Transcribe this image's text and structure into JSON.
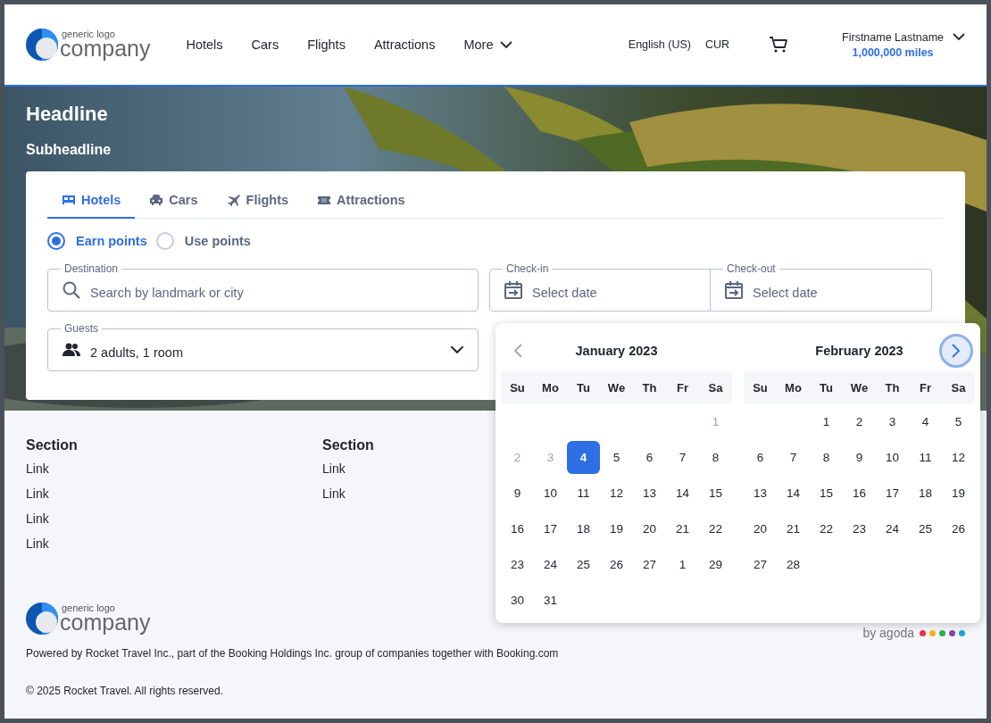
{
  "header": {
    "logo": {
      "tagline": "generic logo",
      "name": "company"
    },
    "nav": [
      {
        "label": "Hotels",
        "has_menu": false
      },
      {
        "label": "Cars",
        "has_menu": false
      },
      {
        "label": "Flights",
        "has_menu": false
      },
      {
        "label": "Attractions",
        "has_menu": false
      },
      {
        "label": "More",
        "has_menu": true
      }
    ],
    "language": "English (US)",
    "currency": "CUR",
    "user": {
      "name": "Firstname Lastname",
      "miles": "1,000,000 miles"
    }
  },
  "hero": {
    "headline": "Headline",
    "subheadline": "Subheadline"
  },
  "search_card": {
    "tabs": [
      {
        "label": "Hotels",
        "selected": true
      },
      {
        "label": "Cars",
        "selected": false
      },
      {
        "label": "Flights",
        "selected": false
      },
      {
        "label": "Attractions",
        "selected": false
      }
    ],
    "point_options": [
      {
        "label": "Earn points",
        "selected": true
      },
      {
        "label": "Use points",
        "selected": false
      }
    ],
    "fields": [
      {
        "kind": "search",
        "label": "Destination",
        "placeholder": "Search by landmark or city"
      },
      {
        "kind": "date",
        "label": "Check-in",
        "placeholder": "Select date"
      },
      {
        "kind": "date",
        "label": "Check-out",
        "placeholder": "Select date"
      },
      {
        "kind": "select",
        "label": "Guests",
        "value": "2 adults, 1 room"
      }
    ]
  },
  "calendar": {
    "prev_button": {
      "disabled": true
    },
    "next_button": {
      "focused": true
    },
    "months": [
      {
        "title": "January  2023",
        "weekdays": [
          "Su",
          "Mo",
          "Tu",
          "We",
          "Th",
          "Fr",
          "Sa"
        ],
        "weeks": [
          {
            "days": [
              {
                "label": "1",
                "disabled": true,
                "selected": false
              }
            ]
          },
          {
            "days": [
              {
                "label": "2",
                "disabled": true,
                "selected": false
              },
              {
                "label": "3",
                "disabled": true,
                "selected": false
              },
              {
                "label": "4",
                "disabled": false,
                "selected": true
              },
              {
                "label": "5",
                "disabled": false,
                "selected": false
              },
              {
                "label": "6",
                "disabled": false,
                "selected": false
              },
              {
                "label": "7",
                "disabled": false,
                "selected": false
              },
              {
                "label": "8",
                "disabled": false,
                "selected": false
              }
            ]
          },
          {
            "days": [
              {
                "label": "9",
                "disabled": false,
                "selected": false
              },
              {
                "label": "10",
                "disabled": false,
                "selected": false
              },
              {
                "label": "11",
                "disabled": false,
                "selected": false
              },
              {
                "label": "12",
                "disabled": false,
                "selected": false
              },
              {
                "label": "13",
                "disabled": false,
                "selected": false
              },
              {
                "label": "14",
                "disabled": false,
                "selected": false
              },
              {
                "label": "15",
                "disabled": false,
                "selected": false
              }
            ]
          },
          {
            "days": [
              {
                "label": "16",
                "disabled": false,
                "selected": false
              },
              {
                "label": "17",
                "disabled": false,
                "selected": false
              },
              {
                "label": "18",
                "disabled": false,
                "selected": false
              },
              {
                "label": "19",
                "disabled": false,
                "selected": false
              },
              {
                "label": "20",
                "disabled": false,
                "selected": false
              },
              {
                "label": "21",
                "disabled": false,
                "selected": false
              },
              {
                "label": "22",
                "disabled": false,
                "selected": false
              }
            ]
          },
          {
            "days": [
              {
                "label": "23",
                "disabled": false,
                "selected": false
              },
              {
                "label": "24",
                "disabled": false,
                "selected": false
              },
              {
                "label": "25",
                "disabled": false,
                "selected": false
              },
              {
                "label": "26",
                "disabled": false,
                "selected": false
              },
              {
                "label": "27",
                "disabled": false,
                "selected": false
              },
              {
                "label": "1",
                "disabled": false,
                "selected": false
              },
              {
                "label": "29",
                "disabled": false,
                "selected": false
              }
            ]
          },
          {
            "days": [
              {
                "label": "30",
                "disabled": false,
                "selected": false
              },
              {
                "label": "31",
                "disabled": false,
                "selected": false
              }
            ]
          }
        ]
      },
      {
        "title": "February  2023",
        "weekdays": [
          "Su",
          "Mo",
          "Tu",
          "We",
          "Th",
          "Fr",
          "Sa"
        ],
        "weeks": [
          {
            "days": [
              {
                "label": "1",
                "disabled": false,
                "selected": false
              },
              {
                "label": "2",
                "disabled": false,
                "selected": false
              },
              {
                "label": "3",
                "disabled": false,
                "selected": false
              },
              {
                "label": "4",
                "disabled": false,
                "selected": false
              },
              {
                "label": "5",
                "disabled": false,
                "selected": false
              }
            ]
          },
          {
            "days": [
              {
                "label": "6",
                "disabled": false,
                "selected": false
              },
              {
                "label": "7",
                "disabled": false,
                "selected": false
              },
              {
                "label": "8",
                "disabled": false,
                "selected": false
              },
              {
                "label": "9",
                "disabled": false,
                "selected": false
              },
              {
                "label": "10",
                "disabled": false,
                "selected": false
              },
              {
                "label": "11",
                "disabled": false,
                "selected": false
              },
              {
                "label": "12",
                "disabled": false,
                "selected": false
              }
            ]
          },
          {
            "days": [
              {
                "label": "13",
                "disabled": false,
                "selected": false
              },
              {
                "label": "14",
                "disabled": false,
                "selected": false
              },
              {
                "label": "15",
                "disabled": false,
                "selected": false
              },
              {
                "label": "16",
                "disabled": false,
                "selected": false
              },
              {
                "label": "17",
                "disabled": false,
                "selected": false
              },
              {
                "label": "18",
                "disabled": false,
                "selected": false
              },
              {
                "label": "19",
                "disabled": false,
                "selected": false
              }
            ]
          },
          {
            "days": [
              {
                "label": "20",
                "disabled": false,
                "selected": false
              },
              {
                "label": "21",
                "disabled": false,
                "selected": false
              },
              {
                "label": "22",
                "disabled": false,
                "selected": false
              },
              {
                "label": "23",
                "disabled": false,
                "selected": false
              },
              {
                "label": "24",
                "disabled": false,
                "selected": false
              },
              {
                "label": "25",
                "disabled": false,
                "selected": false
              },
              {
                "label": "26",
                "disabled": false,
                "selected": false
              }
            ]
          },
          {
            "days": [
              {
                "label": "27",
                "disabled": false,
                "selected": false
              },
              {
                "label": "28",
                "disabled": false,
                "selected": false
              }
            ]
          }
        ]
      }
    ]
  },
  "footer": {
    "sections": [
      {
        "title": "Section",
        "links": [
          "Link",
          "Link",
          "Link",
          "Link"
        ]
      },
      {
        "title": "Section",
        "links": [
          "Link",
          "Link"
        ]
      }
    ],
    "logo": {
      "tagline": "generic logo",
      "name": "company"
    },
    "partner": {
      "text": "by agoda",
      "dots": [
        {
          "color": "#e8363f"
        },
        {
          "color": "#f9b21b"
        },
        {
          "color": "#26b14c"
        },
        {
          "color": "#9440a8"
        },
        {
          "color": "#1aa4de"
        }
      ]
    },
    "powered_by": "Powered by Rocket Travel Inc., part of the Booking Holdings Inc. group of companies together with Booking.com",
    "copyright": "© 2025 Rocket Travel. All rights reserved."
  }
}
